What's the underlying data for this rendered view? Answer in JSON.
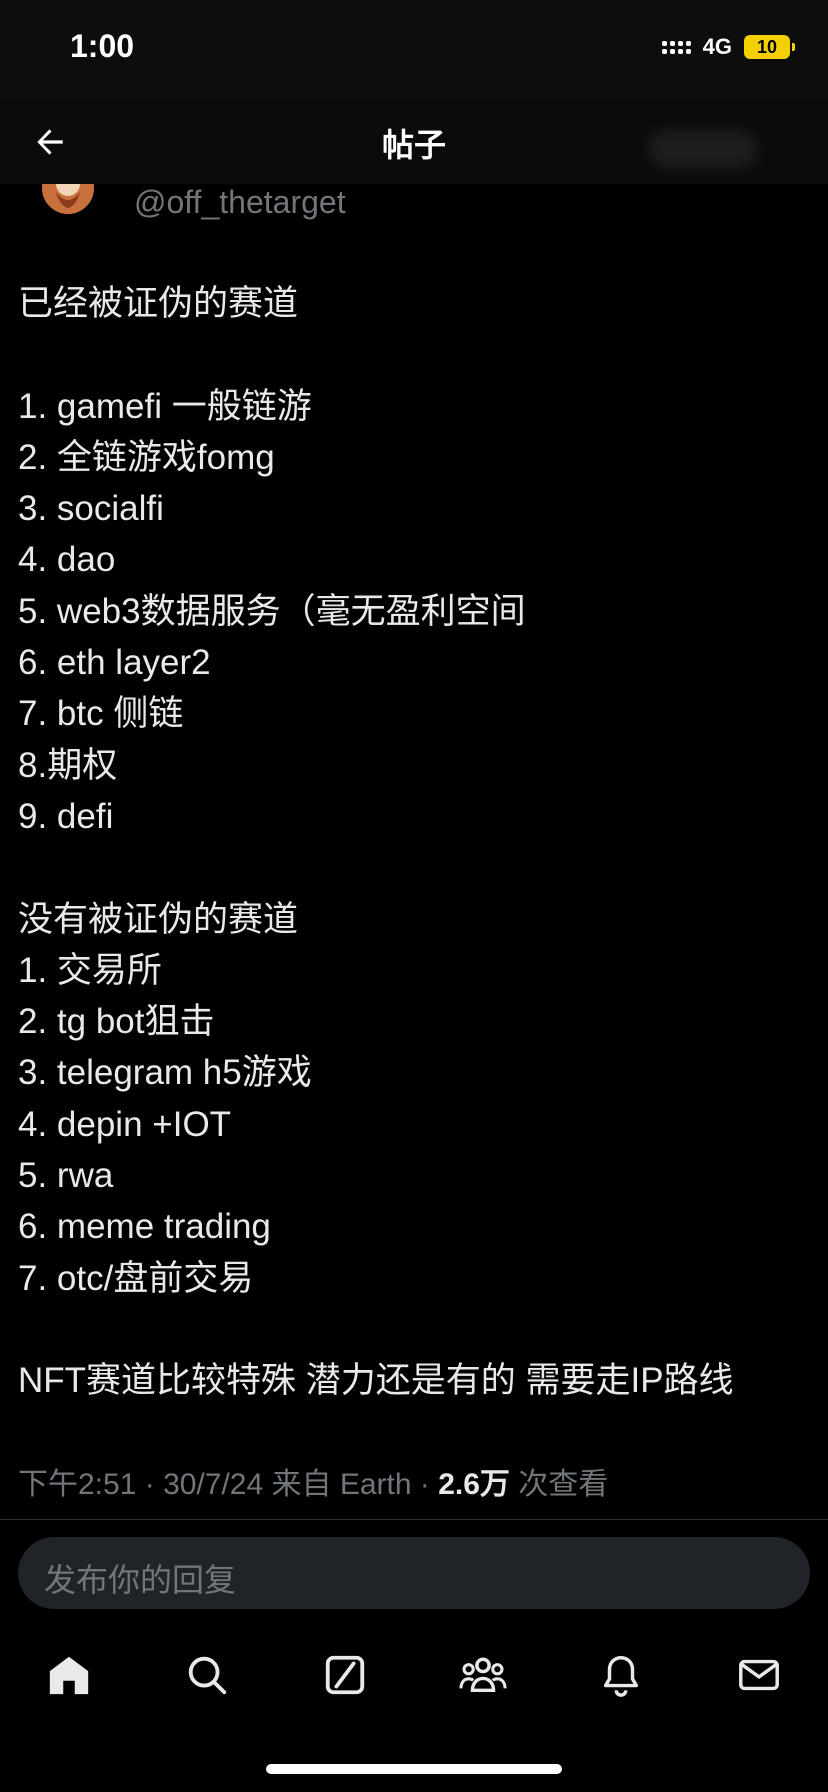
{
  "status": {
    "time": "1:00",
    "network": "4G",
    "battery": "10"
  },
  "header": {
    "title": "帖子",
    "back_icon": "arrow-left-icon"
  },
  "author": {
    "handle": "@off_thetarget"
  },
  "post": {
    "lines": [
      "已经被证伪的赛道",
      "",
      "1. gamefi 一般链游",
      "2. 全链游戏fomg",
      "3. socialfi",
      "4. dao",
      "5. web3数据服务（毫无盈利空间",
      "6. eth layer2",
      "7. btc 侧链",
      "8.期权",
      "9. defi",
      "",
      "没有被证伪的赛道",
      "1. 交易所",
      "2. tg bot狙击",
      "3. telegram h5游戏",
      "4. depin +IOT",
      "5. rwa",
      "6. meme trading",
      "7. otc/盘前交易",
      "",
      "NFT赛道比较特殊 潜力还是有的 需要走IP路线"
    ]
  },
  "meta": {
    "time": "下午2:51",
    "date": "30/7/24",
    "source": "来自 Earth",
    "views": "2.6万",
    "views_label": "次查看"
  },
  "reply": {
    "placeholder": "发布你的回复"
  },
  "tabbar": {
    "items": [
      "home-icon",
      "search-icon",
      "grok-icon",
      "communities-icon",
      "bell-icon",
      "mail-icon"
    ]
  }
}
